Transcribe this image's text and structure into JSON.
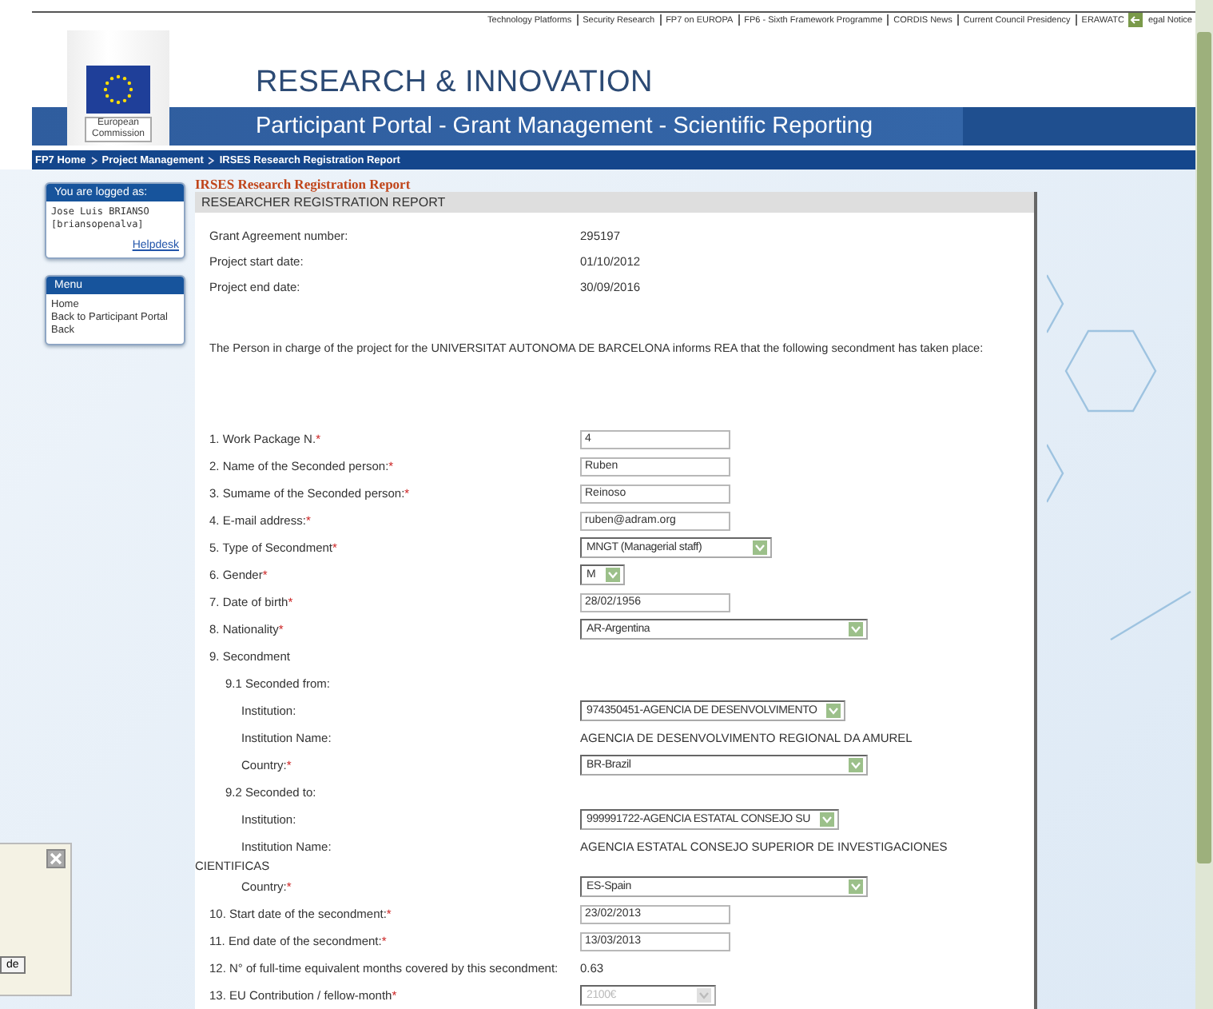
{
  "top_links": [
    "Technology Platforms",
    "Security Research",
    "FP7 on EUROPA",
    "FP6 - Sixth Framework Programme",
    "CORDIS News",
    "Current Council Presidency",
    "ERAWATC",
    "egal Notice"
  ],
  "header": {
    "logo_text": "European Commission",
    "title": "RESEARCH & INNOVATION",
    "subtitle": "Participant Portal - Grant Management - Scientific Reporting"
  },
  "breadcrumb": [
    "FP7 Home",
    "Project Management",
    "IRSES Research Registration Report"
  ],
  "sidebar": {
    "login_title": "You are logged as:",
    "user": "Jose Luis BRIANSO",
    "login": "[briansopenalva]",
    "helpdesk": "Helpdesk",
    "menu_title": "Menu",
    "menu_items": [
      "Home",
      "Back to Participant Portal",
      "Back"
    ]
  },
  "report": {
    "title": "IRSES Research Registration Report",
    "section": "RESEARCHER REGISTRATION REPORT",
    "info": [
      {
        "label": "Grant Agreement number:",
        "value": "295197"
      },
      {
        "label": "Project start date:",
        "value": "01/10/2012"
      },
      {
        "label": "Project end date:",
        "value": "30/09/2016"
      }
    ],
    "statement": "The Person in charge of the project for the UNIVERSITAT AUTONOMA DE BARCELONA informs REA that the following secondment has taken place:",
    "fields": [
      {
        "kind": "input",
        "label": "1. Work Package N.",
        "required_mark": "*",
        "value": "4"
      },
      {
        "kind": "input",
        "label": "2. Name of the Seconded person:",
        "required_mark": "*",
        "value": "Ruben"
      },
      {
        "kind": "input",
        "label": "3. Sumame of the Seconded person:",
        "required_mark": "*",
        "value": "Reinoso"
      },
      {
        "kind": "input",
        "label": "4. E-mail address:",
        "required_mark": "*",
        "value": "ruben@adram.org"
      },
      {
        "kind": "select",
        "label": "5. Type of Secondment",
        "required_mark": "*",
        "value": "MNGT (Managerial staff)"
      },
      {
        "kind": "tinyselect",
        "label": "6. Gender",
        "required_mark": "*",
        "value": "M"
      },
      {
        "kind": "input",
        "label": "7. Date of birth",
        "required_mark": "*",
        "value": "28/02/1956"
      },
      {
        "kind": "wideselect",
        "label": "8. Nationality",
        "required_mark": "*",
        "value": "AR-Argentina"
      },
      {
        "kind": "heading",
        "label": "9. Secondment",
        "children": [
          {
            "kind": "heading",
            "label": "9.1 Seconded from:",
            "children": [
              {
                "kind": "select",
                "label": "Institution:",
                "value": "974350451-AGENCIA DE DESENVOLVIMENTO"
              },
              {
                "kind": "text",
                "label": "Institution Name:",
                "value": "AGENCIA DE DESENVOLVIMENTO REGIONAL DA AMUREL"
              },
              {
                "kind": "wideselect",
                "label": "Country:",
                "required_mark": "*",
                "value": "BR-Brazil"
              }
            ]
          },
          {
            "kind": "heading",
            "label": "9.2 Seconded to:",
            "children": [
              {
                "kind": "select",
                "label": "Institution:",
                "value": "999991722-AGENCIA ESTATAL CONSEJO SU"
              },
              {
                "kind": "text",
                "label": "Institution Name:",
                "value": "AGENCIA ESTATAL CONSEJO SUPERIOR DE INVESTIGACIONES",
                "overflow": "CIENTIFICAS"
              },
              {
                "kind": "wideselect",
                "label": "Country:",
                "required_mark": "*",
                "value": "ES-Spain"
              }
            ]
          }
        ]
      },
      {
        "kind": "input",
        "label": "10. Start date of the secondment:",
        "required_mark": "*",
        "value": "23/02/2013"
      },
      {
        "kind": "input",
        "label": "11. End date of the secondment:",
        "required_mark": "*",
        "value": "13/03/2013"
      },
      {
        "kind": "text",
        "label": "12. N° of full-time equivalent months covered by this secondment:",
        "value": "0.63"
      },
      {
        "kind": "smallselect",
        "disabled": true,
        "label": "13. EU Contribution / fellow-month",
        "required_mark": "*",
        "value": "2100€"
      }
    ]
  },
  "popup": {
    "button": "de"
  }
}
